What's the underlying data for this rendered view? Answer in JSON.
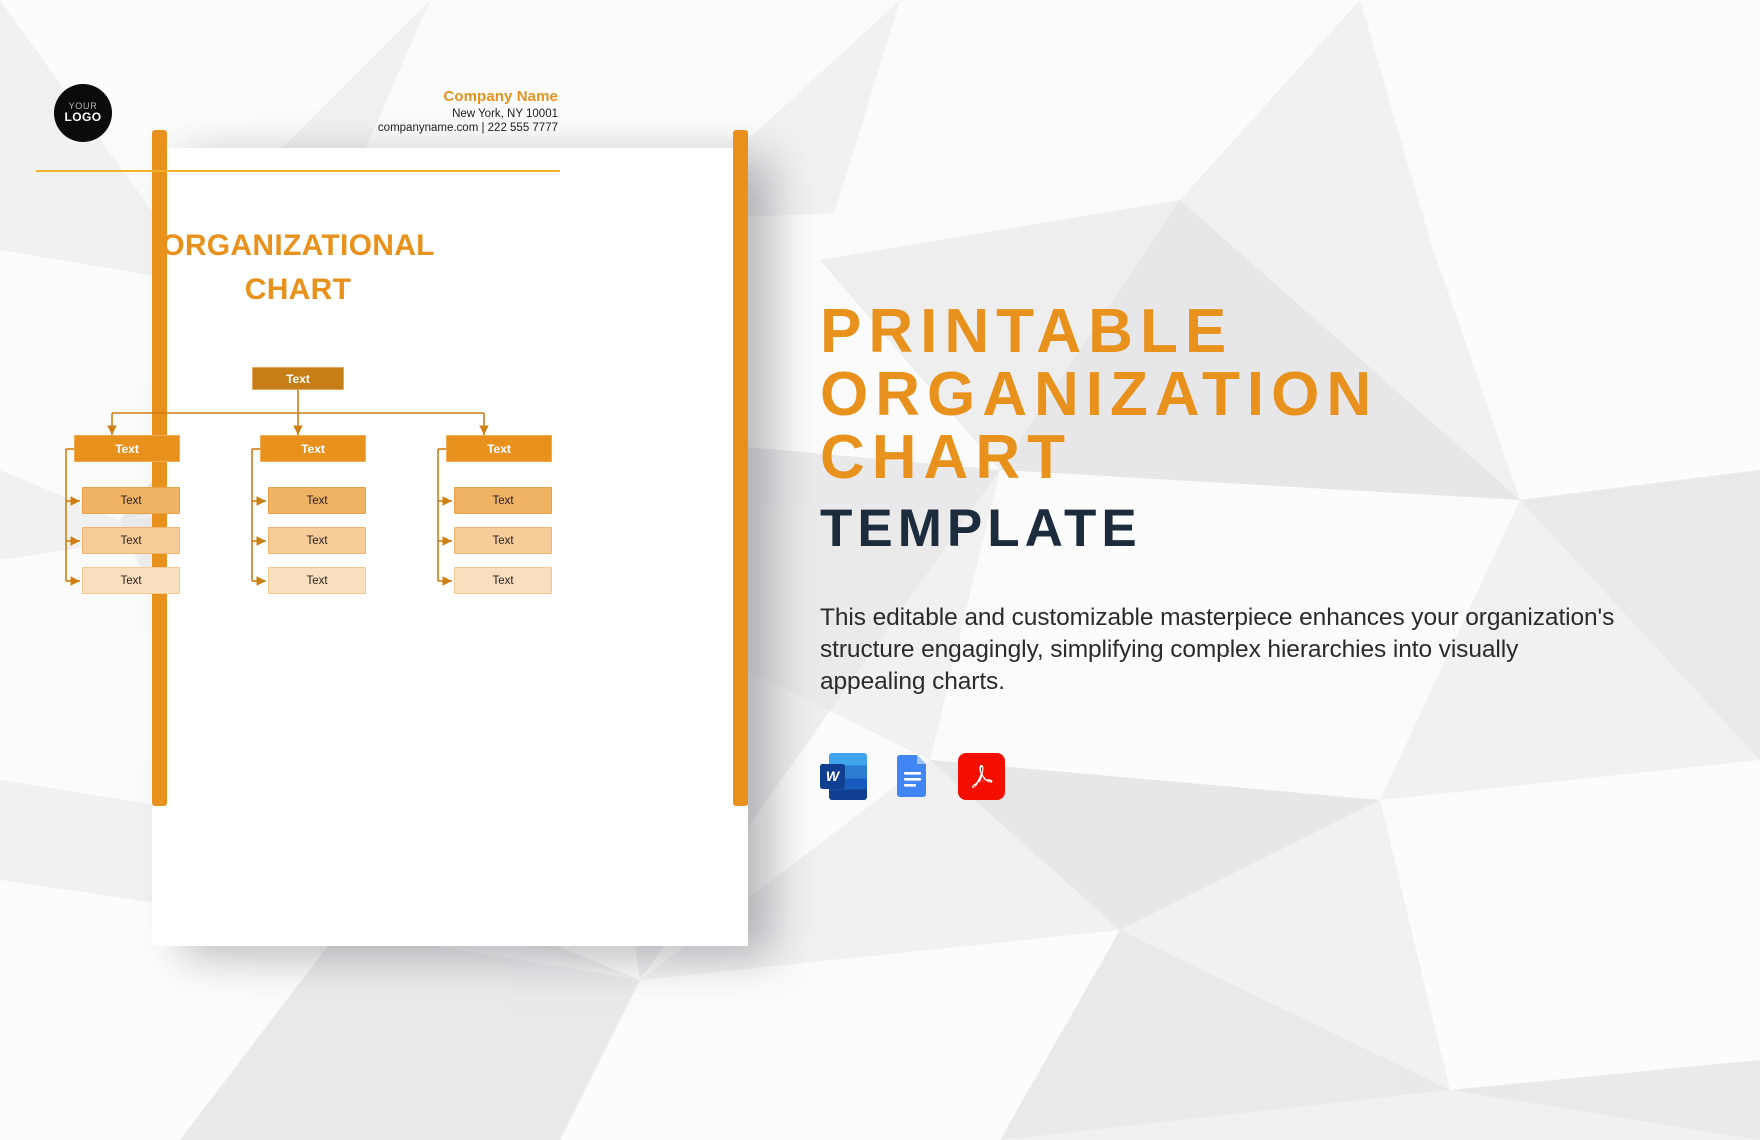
{
  "background": {
    "base_color": "#f2f2f3",
    "pattern": "low-poly-geometric-facets"
  },
  "document": {
    "letterhead": {
      "logo": {
        "top_text": "YOUR",
        "main_text": "LOGO"
      },
      "company_name": "Company Name",
      "address": "New York, NY 10001",
      "contact": "companyname.com | 222 555 7777"
    },
    "title_line1": "ORGANIZATIONAL",
    "title_line2": "CHART",
    "chart": {
      "root": {
        "label": "Text"
      },
      "branches": [
        {
          "head": {
            "label": "Text"
          },
          "children": [
            {
              "label": "Text"
            },
            {
              "label": "Text"
            },
            {
              "label": "Text"
            }
          ]
        },
        {
          "head": {
            "label": "Text"
          },
          "children": [
            {
              "label": "Text"
            },
            {
              "label": "Text"
            },
            {
              "label": "Text"
            }
          ]
        },
        {
          "head": {
            "label": "Text"
          },
          "children": [
            {
              "label": "Text"
            },
            {
              "label": "Text"
            },
            {
              "label": "Text"
            }
          ]
        }
      ]
    }
  },
  "promo": {
    "headline_line1": "PRINTABLE",
    "headline_line2": "ORGANIZATION",
    "headline_line3": "CHART",
    "headline_sub": "TEMPLATE",
    "description": "This editable and customizable masterpiece enhances your organization's structure engagingly, simplifying complex hierarchies into visually appealing charts.",
    "formats": [
      {
        "name": "microsoft-word",
        "label": "W"
      },
      {
        "name": "google-docs",
        "label": ""
      },
      {
        "name": "adobe-pdf",
        "label": ""
      }
    ]
  },
  "colors": {
    "accent_orange": "#e8921d",
    "dark_navy": "#1d2c3c",
    "chart_root": "#c87e16",
    "chart_level1": "#e8921d",
    "chart_level2a": "#f0b263",
    "chart_level2b": "#f6cc98",
    "chart_level2c": "#fadfbe",
    "connector": "#cf7f12",
    "word_blue": "#185abd",
    "gdocs_blue": "#4285f4",
    "pdf_red": "#f40f02"
  }
}
